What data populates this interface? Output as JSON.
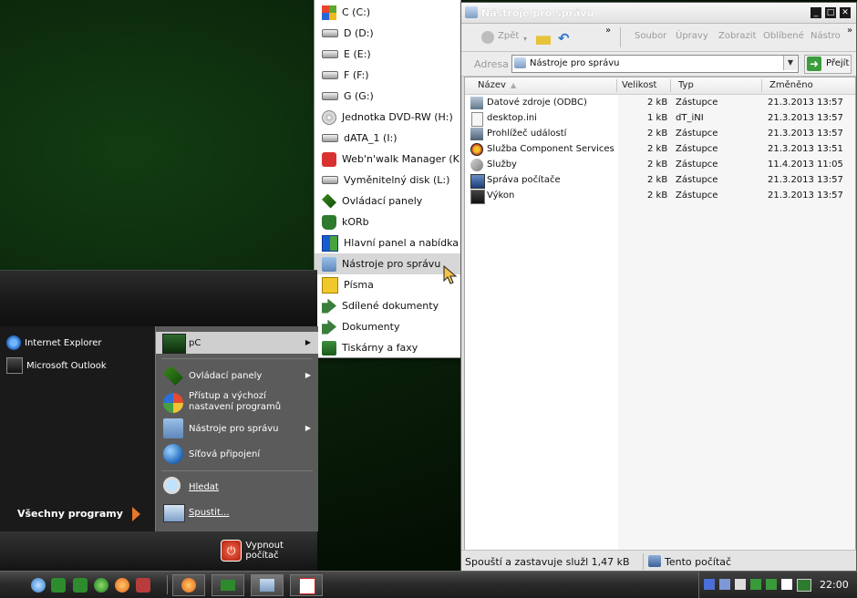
{
  "places_menu": {
    "items": [
      {
        "label": "C (C:)",
        "icon": "windows-drive-icon"
      },
      {
        "label": "D (D:)",
        "icon": "drive-icon"
      },
      {
        "label": "E (E:)",
        "icon": "drive-icon"
      },
      {
        "label": "F (F:)",
        "icon": "drive-icon"
      },
      {
        "label": "G (G:)",
        "icon": "drive-icon"
      },
      {
        "label": "Jednotka DVD-RW (H:)",
        "icon": "dvd-drive-icon"
      },
      {
        "label": "dATA_1 (I:)",
        "icon": "drive-icon"
      },
      {
        "label": "Web'n'walk Manager (K:)",
        "icon": "webnwalk-icon"
      },
      {
        "label": "Vyměnitelný disk (L:)",
        "icon": "removable-disk-icon"
      },
      {
        "label": "Ovládací panely",
        "icon": "control-panel-icon"
      },
      {
        "label": "kORb",
        "icon": "recycle-bin-icon"
      },
      {
        "label": "Hlavní panel a nabídka Start",
        "icon": "taskbar-start-icon"
      },
      {
        "label": "Nástroje pro správu",
        "icon": "admin-tools-icon"
      },
      {
        "label": "Písma",
        "icon": "fonts-folder-icon"
      },
      {
        "label": "Sdílené dokumenty",
        "icon": "shared-docs-icon"
      },
      {
        "label": "Dokumenty",
        "icon": "documents-icon"
      },
      {
        "label": "Tiskárny a faxy",
        "icon": "printers-icon"
      }
    ],
    "selected_index": 12
  },
  "explorer": {
    "title": "Nástroje pro správu",
    "toolbar": {
      "back": "Zpět",
      "menus": [
        "Soubor",
        "Úpravy",
        "Zobrazit",
        "Oblíbené",
        "Nástro"
      ]
    },
    "address": {
      "label": "Adresa",
      "value": "Nástroje pro správu",
      "go": "Přejít"
    },
    "columns": [
      "Název",
      "Velikost",
      "Typ",
      "Změněno"
    ],
    "files": [
      {
        "name": "Datové zdroje (ODBC)",
        "size": "2 kB",
        "type": "Zástupce",
        "modified": "21.3.2013 13:57"
      },
      {
        "name": "desktop.ini",
        "size": "1 kB",
        "type": "dT_iNI",
        "modified": "21.3.2013 13:57"
      },
      {
        "name": "Prohlížeč událostí",
        "size": "2 kB",
        "type": "Zástupce",
        "modified": "21.3.2013 13:57"
      },
      {
        "name": "Služba Component Services",
        "size": "2 kB",
        "type": "Zástupce",
        "modified": "21.3.2013 13:51"
      },
      {
        "name": "Služby",
        "size": "2 kB",
        "type": "Zástupce",
        "modified": "11.4.2013 11:05"
      },
      {
        "name": "Správa počítače",
        "size": "2 kB",
        "type": "Zástupce",
        "modified": "21.3.2013 13:57"
      },
      {
        "name": "Výkon",
        "size": "2 kB",
        "type": "Zástupce",
        "modified": "21.3.2013 13:57"
      }
    ],
    "status": {
      "text": "Spouští a zastavuje služl 1,47 kB",
      "location": "Tento počítač"
    }
  },
  "start_menu": {
    "pinned": [
      {
        "label": "Internet Explorer",
        "icon": "internet-explorer-icon"
      },
      {
        "label": "Microsoft Outlook",
        "icon": "outlook-icon"
      }
    ],
    "all_programs": "Všechny programy",
    "right": [
      {
        "label": "pC",
        "icon": "computer-icon",
        "arrow": true
      },
      {
        "label": "Ovládací panely",
        "icon": "control-panel-icon",
        "arrow": true
      },
      {
        "label": "Přístup a výchozí nastavení programů",
        "icon": "default-programs-icon",
        "arrow": false
      },
      {
        "label": "Nástroje pro správu",
        "icon": "admin-tools-icon",
        "arrow": true
      },
      {
        "label": "Síťová připojení",
        "icon": "network-icon",
        "arrow": false
      },
      {
        "label": "Hledat",
        "icon": "search-icon",
        "arrow": false
      },
      {
        "label": "Spustit...",
        "icon": "run-icon",
        "arrow": false
      }
    ],
    "shutdown": "Vypnout počítač"
  },
  "taskbar": {
    "clock": "22:00"
  }
}
